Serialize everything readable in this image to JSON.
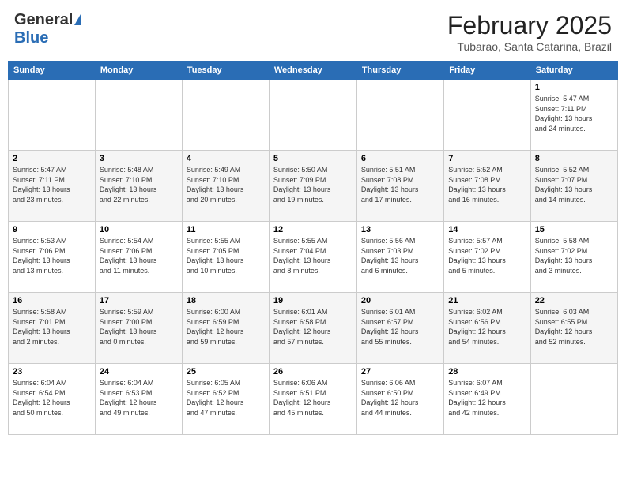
{
  "header": {
    "logo_general": "General",
    "logo_blue": "Blue",
    "title": "February 2025",
    "subtitle": "Tubarao, Santa Catarina, Brazil"
  },
  "calendar": {
    "days_of_week": [
      "Sunday",
      "Monday",
      "Tuesday",
      "Wednesday",
      "Thursday",
      "Friday",
      "Saturday"
    ],
    "weeks": [
      [
        {
          "day": "",
          "details": ""
        },
        {
          "day": "",
          "details": ""
        },
        {
          "day": "",
          "details": ""
        },
        {
          "day": "",
          "details": ""
        },
        {
          "day": "",
          "details": ""
        },
        {
          "day": "",
          "details": ""
        },
        {
          "day": "1",
          "details": "Sunrise: 5:47 AM\nSunset: 7:11 PM\nDaylight: 13 hours\nand 24 minutes."
        }
      ],
      [
        {
          "day": "2",
          "details": "Sunrise: 5:47 AM\nSunset: 7:11 PM\nDaylight: 13 hours\nand 23 minutes."
        },
        {
          "day": "3",
          "details": "Sunrise: 5:48 AM\nSunset: 7:10 PM\nDaylight: 13 hours\nand 22 minutes."
        },
        {
          "day": "4",
          "details": "Sunrise: 5:49 AM\nSunset: 7:10 PM\nDaylight: 13 hours\nand 20 minutes."
        },
        {
          "day": "5",
          "details": "Sunrise: 5:50 AM\nSunset: 7:09 PM\nDaylight: 13 hours\nand 19 minutes."
        },
        {
          "day": "6",
          "details": "Sunrise: 5:51 AM\nSunset: 7:08 PM\nDaylight: 13 hours\nand 17 minutes."
        },
        {
          "day": "7",
          "details": "Sunrise: 5:52 AM\nSunset: 7:08 PM\nDaylight: 13 hours\nand 16 minutes."
        },
        {
          "day": "8",
          "details": "Sunrise: 5:52 AM\nSunset: 7:07 PM\nDaylight: 13 hours\nand 14 minutes."
        }
      ],
      [
        {
          "day": "9",
          "details": "Sunrise: 5:53 AM\nSunset: 7:06 PM\nDaylight: 13 hours\nand 13 minutes."
        },
        {
          "day": "10",
          "details": "Sunrise: 5:54 AM\nSunset: 7:06 PM\nDaylight: 13 hours\nand 11 minutes."
        },
        {
          "day": "11",
          "details": "Sunrise: 5:55 AM\nSunset: 7:05 PM\nDaylight: 13 hours\nand 10 minutes."
        },
        {
          "day": "12",
          "details": "Sunrise: 5:55 AM\nSunset: 7:04 PM\nDaylight: 13 hours\nand 8 minutes."
        },
        {
          "day": "13",
          "details": "Sunrise: 5:56 AM\nSunset: 7:03 PM\nDaylight: 13 hours\nand 6 minutes."
        },
        {
          "day": "14",
          "details": "Sunrise: 5:57 AM\nSunset: 7:02 PM\nDaylight: 13 hours\nand 5 minutes."
        },
        {
          "day": "15",
          "details": "Sunrise: 5:58 AM\nSunset: 7:02 PM\nDaylight: 13 hours\nand 3 minutes."
        }
      ],
      [
        {
          "day": "16",
          "details": "Sunrise: 5:58 AM\nSunset: 7:01 PM\nDaylight: 13 hours\nand 2 minutes."
        },
        {
          "day": "17",
          "details": "Sunrise: 5:59 AM\nSunset: 7:00 PM\nDaylight: 13 hours\nand 0 minutes."
        },
        {
          "day": "18",
          "details": "Sunrise: 6:00 AM\nSunset: 6:59 PM\nDaylight: 12 hours\nand 59 minutes."
        },
        {
          "day": "19",
          "details": "Sunrise: 6:01 AM\nSunset: 6:58 PM\nDaylight: 12 hours\nand 57 minutes."
        },
        {
          "day": "20",
          "details": "Sunrise: 6:01 AM\nSunset: 6:57 PM\nDaylight: 12 hours\nand 55 minutes."
        },
        {
          "day": "21",
          "details": "Sunrise: 6:02 AM\nSunset: 6:56 PM\nDaylight: 12 hours\nand 54 minutes."
        },
        {
          "day": "22",
          "details": "Sunrise: 6:03 AM\nSunset: 6:55 PM\nDaylight: 12 hours\nand 52 minutes."
        }
      ],
      [
        {
          "day": "23",
          "details": "Sunrise: 6:04 AM\nSunset: 6:54 PM\nDaylight: 12 hours\nand 50 minutes."
        },
        {
          "day": "24",
          "details": "Sunrise: 6:04 AM\nSunset: 6:53 PM\nDaylight: 12 hours\nand 49 minutes."
        },
        {
          "day": "25",
          "details": "Sunrise: 6:05 AM\nSunset: 6:52 PM\nDaylight: 12 hours\nand 47 minutes."
        },
        {
          "day": "26",
          "details": "Sunrise: 6:06 AM\nSunset: 6:51 PM\nDaylight: 12 hours\nand 45 minutes."
        },
        {
          "day": "27",
          "details": "Sunrise: 6:06 AM\nSunset: 6:50 PM\nDaylight: 12 hours\nand 44 minutes."
        },
        {
          "day": "28",
          "details": "Sunrise: 6:07 AM\nSunset: 6:49 PM\nDaylight: 12 hours\nand 42 minutes."
        },
        {
          "day": "",
          "details": ""
        }
      ]
    ]
  }
}
